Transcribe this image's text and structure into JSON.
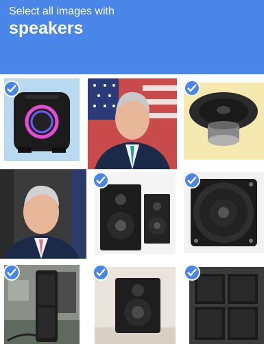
{
  "header": {
    "instruction": "Select all images with",
    "object": "speakers",
    "color": "#4a86e8"
  },
  "tiles": [
    {
      "subject": "party-speaker",
      "selected": true
    },
    {
      "subject": "politician-portrait-flag",
      "selected": false
    },
    {
      "subject": "speaker-driver",
      "selected": true
    },
    {
      "subject": "politician-portrait",
      "selected": false
    },
    {
      "subject": "bookshelf-speakers",
      "selected": true
    },
    {
      "subject": "speaker-driver-front",
      "selected": true
    },
    {
      "subject": "pa-speaker",
      "selected": true
    },
    {
      "subject": "studio-monitor",
      "selected": true
    },
    {
      "subject": "speaker-stack",
      "selected": true
    }
  ],
  "icons": {
    "check": "checkmark-icon"
  }
}
